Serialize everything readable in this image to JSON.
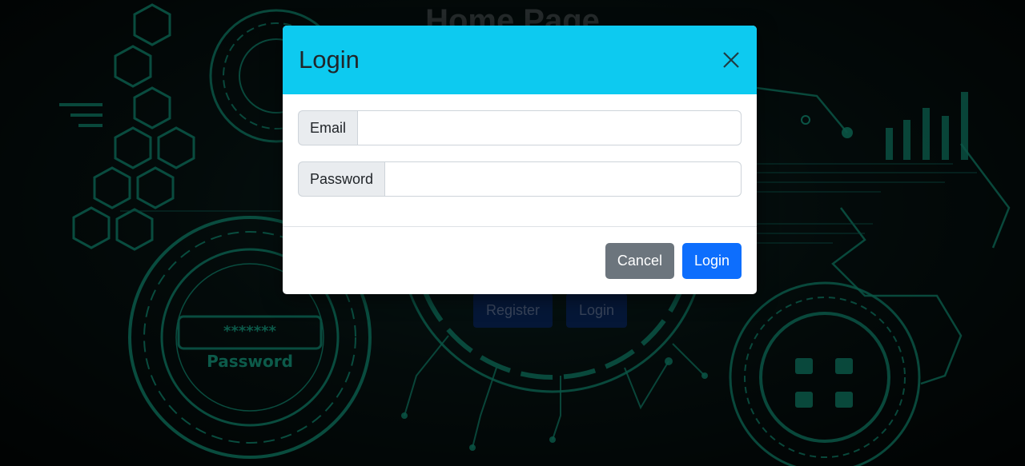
{
  "page": {
    "title": "Home Page",
    "register_label": "Register",
    "login_label": "Login",
    "background_image_text": "Password"
  },
  "modal": {
    "title": "Login",
    "fields": [
      {
        "label": "Email",
        "value": "",
        "placeholder": ""
      },
      {
        "label": "Password",
        "value": "",
        "placeholder": ""
      }
    ],
    "cancel_label": "Cancel",
    "submit_label": "Login"
  },
  "colors": {
    "header": "#0dcaf0",
    "primary": "#0d6efd",
    "secondary": "#6c757d",
    "accent": "#1abc9c"
  }
}
